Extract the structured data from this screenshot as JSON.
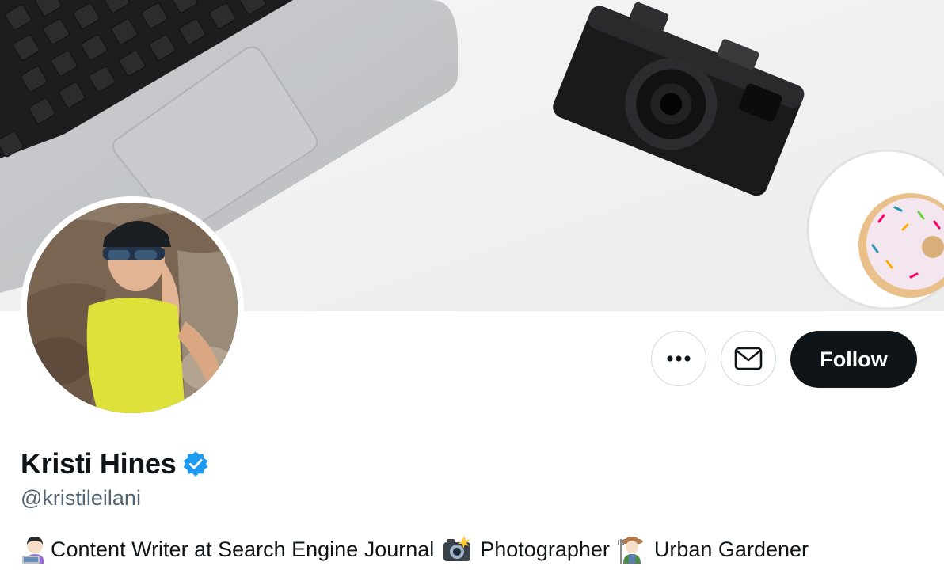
{
  "profile": {
    "display_name": "Kristi Hines",
    "handle": "@kristileilani",
    "verified": true,
    "bio": {
      "part1": "Content Writer at Search Engine Journal",
      "part2": "Photographer",
      "part3": "Urban Gardener",
      "icons": [
        "woman-technologist-emoji",
        "camera-with-flash-emoji",
        "woman-farmer-emoji"
      ]
    }
  },
  "actions": {
    "follow_label": "Follow",
    "more_icon": "more-icon",
    "message_icon": "envelope-icon"
  },
  "colors": {
    "follow_bg": "#0f1419",
    "verified_blue": "#1d9bf0",
    "handle_gray": "#536471",
    "button_border": "#cfd9de"
  }
}
